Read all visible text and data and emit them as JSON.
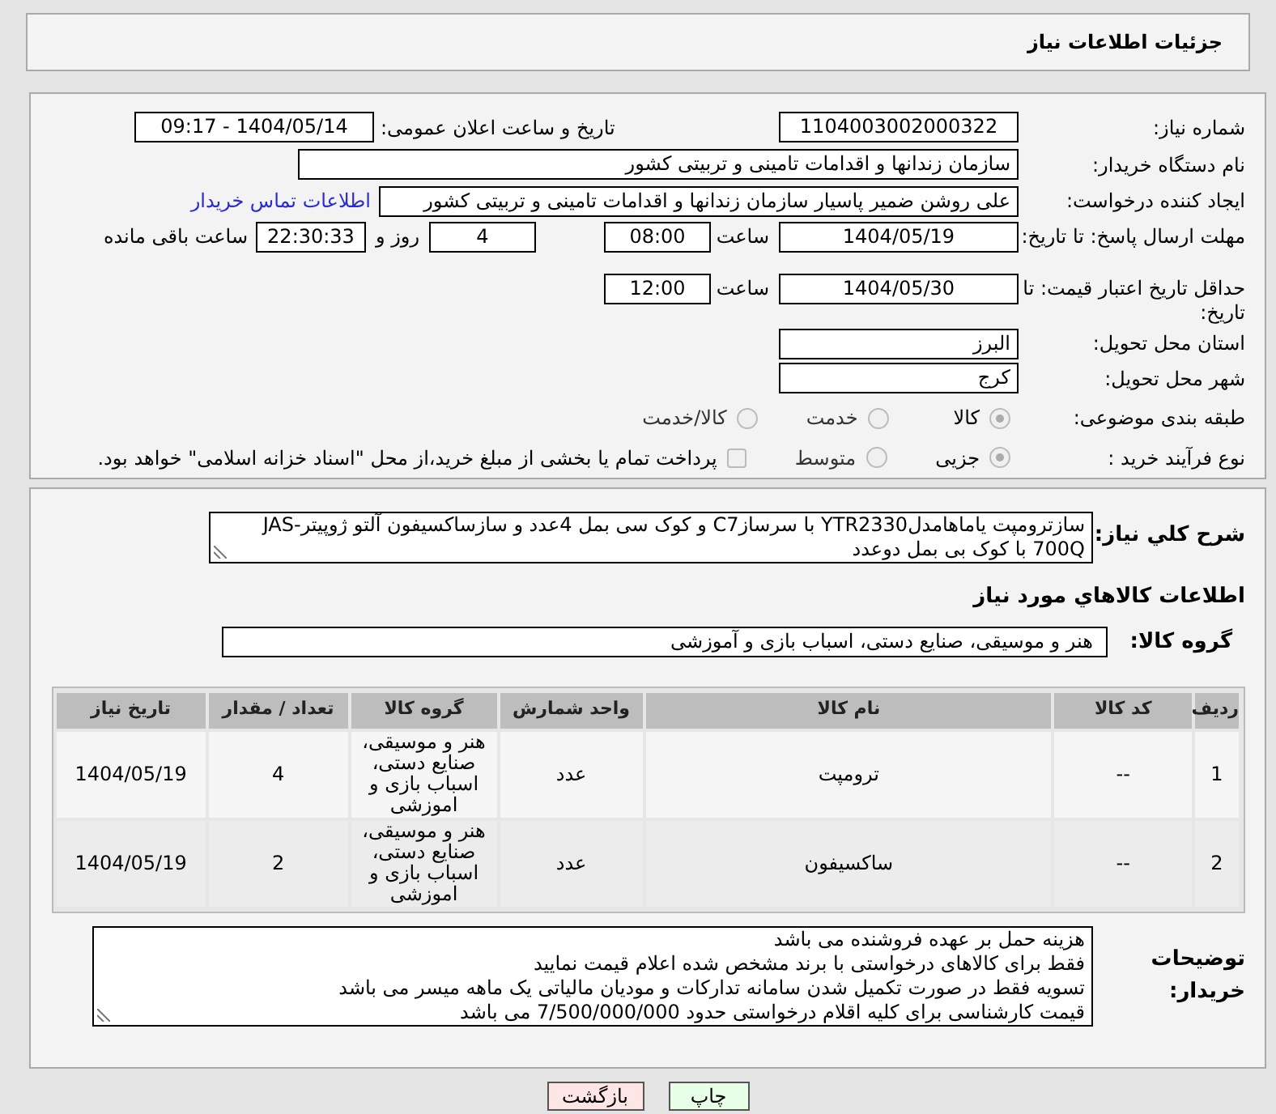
{
  "title": "جزئیات اطلاعات نیاز",
  "need_number": {
    "label": "شماره نیاز:",
    "value": "1104003002000322"
  },
  "announce": {
    "label": "تاریخ و ساعت اعلان عمومی:",
    "value": "1404/05/14 - 09:17"
  },
  "buyer_org": {
    "label": "نام دستگاه خریدار:",
    "value": "سازمان زندانها و اقدامات تامینی و تربیتی کشور"
  },
  "requester": {
    "label": "ایجاد کننده درخواست:",
    "value": "علی روشن ضمیر پاسیار سازمان زندانها و اقدامات تامینی و تربیتی کشور",
    "link": "اطلاعات تماس خریدار"
  },
  "deadline": {
    "label": "مهلت ارسال پاسخ: تا تاریخ:",
    "date": "1404/05/19",
    "time_label": "ساعت",
    "time": "08:00",
    "days": "4",
    "days_label": "روز و",
    "remaining": "22:30:33",
    "remaining_label": "ساعت باقی مانده"
  },
  "validity": {
    "label": "حداقل تاریخ اعتبار قیمت: تا تاریخ:",
    "date": "1404/05/30",
    "time_label": "ساعت",
    "time": "12:00"
  },
  "province": {
    "label": "استان محل تحویل:",
    "value": "البرز"
  },
  "city": {
    "label": "شهر محل تحویل:",
    "value": "کرج"
  },
  "category": {
    "label": "طبقه بندی موضوعی:",
    "options": [
      {
        "label": "کالا",
        "selected": true
      },
      {
        "label": "خدمت",
        "selected": false
      },
      {
        "label": "کالا/خدمت",
        "selected": false
      }
    ]
  },
  "process": {
    "label": "نوع فرآیند خرید :",
    "options": [
      {
        "label": "جزیی",
        "selected": true
      },
      {
        "label": "متوسط",
        "selected": false
      }
    ],
    "payment": {
      "label": "پرداخت تمام یا بخشی از مبلغ خرید،از محل \"اسناد خزانه اسلامی\" خواهد بود.",
      "checked": false
    }
  },
  "description": {
    "label": "شرح کلي نياز:",
    "value": "سازترومپت یاماهامدلYTR2330 با سرسازC7 و کوک سی بمل 4عدد و سازساکسیفون آلتو ژوپیترJAS-700Q با کوک بی بمل دوعدد"
  },
  "goods_heading": "اطلاعات کالاهاي مورد نياز",
  "goods_group": {
    "label": "گروه کالا:",
    "value": "هنر و موسیقی، صنایع دستی، اسباب بازی و آموزشی"
  },
  "table": {
    "columns": [
      "ردیف",
      "کد کالا",
      "نام کالا",
      "واحد شمارش",
      "گروه کالا",
      "تعداد / مقدار",
      "تاریخ نیاز"
    ],
    "rows": [
      [
        "1",
        "--",
        "ترومپت",
        "عدد",
        "هنر و موسیقی، صنایع دستی، اسباب بازی و اموزشی",
        "4",
        "1404/05/19"
      ],
      [
        "2",
        "--",
        "ساکسیفون",
        "عدد",
        "هنر و موسیقی، صنایع دستی، اسباب بازی و اموزشی",
        "2",
        "1404/05/19"
      ]
    ]
  },
  "buyer_notes": {
    "label": "توضیحات خریدار:",
    "lines": [
      "هزینه حمل بر عهده فروشنده می باشد",
      "فقط برای کالاهای درخواستی با برند مشخص شده اعلام قیمت نمایید",
      "تسویه فقط در صورت تکمیل شدن سامانه تدارکات و مودیان مالیاتی یک ماهه میسر می باشد",
      "قیمت کارشناسی برای کلیه اقلام درخواستی حدود 7/500/000/000 می باشد"
    ]
  },
  "buttons": [
    {
      "label": "چاپ",
      "kind": "print"
    },
    {
      "label": "بازگشت",
      "kind": "back"
    }
  ]
}
